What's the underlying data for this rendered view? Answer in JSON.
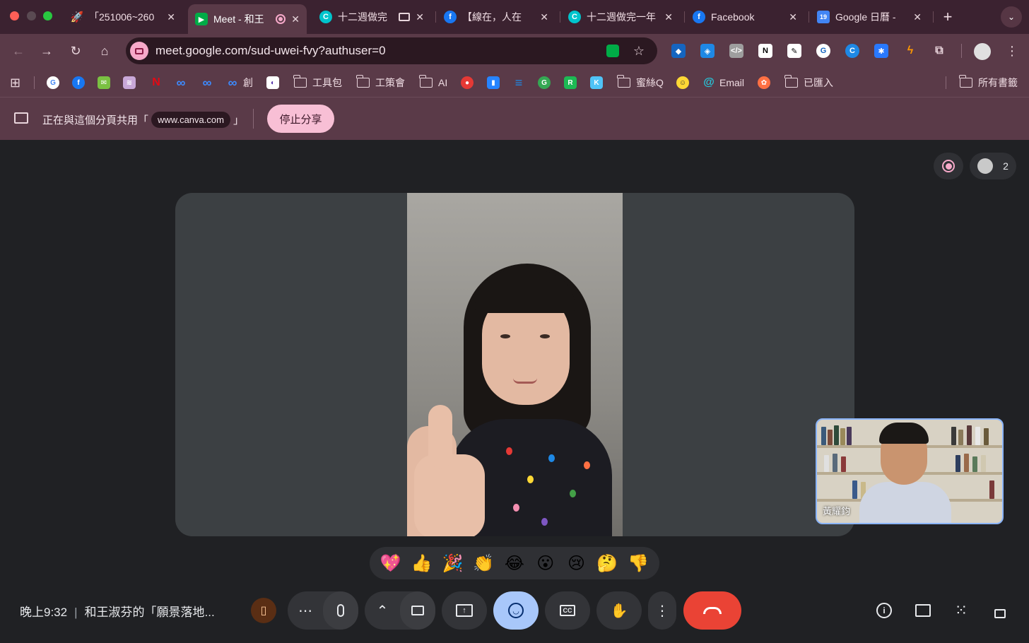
{
  "tabs": [
    {
      "title": "「251006~260",
      "favicon": "rocket-icon",
      "color": "#3b2230"
    },
    {
      "title": "Meet - 和王",
      "favicon": "meet-icon",
      "color": "#00ac47",
      "recording": true
    },
    {
      "title": "十二週做完",
      "favicon": "canva-icon",
      "color": "#00c4cc"
    },
    {
      "title": "【線在，人在",
      "favicon": "facebook-icon",
      "color": "#1877f2"
    },
    {
      "title": "十二週做完一年",
      "favicon": "canva-icon",
      "color": "#00c4cc"
    },
    {
      "title": "Facebook",
      "favicon": "facebook-icon",
      "color": "#1877f2"
    },
    {
      "title": "Google 日曆 -",
      "favicon": "calendar-icon",
      "color": "#4285f4",
      "badge": "19"
    }
  ],
  "tab_close_glyph": "✕",
  "new_tab_glyph": "+",
  "url": "meet.google.com/sud-uwei-fvy?authuser=0",
  "bookmarks": {
    "items": [
      {
        "label": "",
        "icon": "google-icon",
        "color": "#ffffff",
        "glyph": "G"
      },
      {
        "label": "",
        "icon": "facebook-icon",
        "color": "#1877f2",
        "glyph": "f"
      },
      {
        "label": "",
        "icon": "mail-icon",
        "color": "#7ac142",
        "glyph": "✉"
      },
      {
        "label": "",
        "icon": "pattern-icon",
        "color": "#c9a8d8",
        "glyph": "≋"
      },
      {
        "label": "",
        "icon": "netflix-icon",
        "color": "#e50914",
        "glyph": "N"
      },
      {
        "label": "",
        "icon": "meta-icon",
        "color": "#0668e1",
        "glyph": "∞"
      },
      {
        "label": "",
        "icon": "meta-icon",
        "color": "#0668e1",
        "glyph": "∞"
      },
      {
        "label": "創",
        "icon": "meta-icon",
        "color": "#0668e1",
        "glyph": "∞"
      },
      {
        "label": "",
        "icon": "app-icon",
        "color": "#ffffff",
        "glyph": "◐"
      },
      {
        "label": "工具包",
        "icon": "folder-icon"
      },
      {
        "label": "工策會",
        "icon": "folder-icon"
      },
      {
        "label": "AI",
        "icon": "folder-icon"
      },
      {
        "label": "",
        "icon": "red-app-icon",
        "color": "#e53935",
        "glyph": "●"
      },
      {
        "label": "",
        "icon": "trello-icon",
        "color": "#2684ff",
        "glyph": "▮"
      },
      {
        "label": "",
        "icon": "bars-icon",
        "color": "#1e88e5",
        "glyph": "≡"
      },
      {
        "label": "",
        "icon": "green-app-icon",
        "color": "#34a853",
        "glyph": "G"
      },
      {
        "label": "",
        "icon": "r-app-icon",
        "color": "#1db954",
        "glyph": "R"
      },
      {
        "label": "",
        "icon": "k-app-icon",
        "color": "#4fc3f7",
        "glyph": "K"
      },
      {
        "label": "蜜絲Q",
        "icon": "folder-icon"
      },
      {
        "label": "",
        "icon": "smile-app-icon",
        "color": "#fdd835",
        "glyph": "☺"
      },
      {
        "label": "Email",
        "icon": "email-app-icon",
        "color": "#26c6da",
        "glyph": "@"
      },
      {
        "label": "",
        "icon": "orange-app-icon",
        "color": "#ff7043",
        "glyph": "✿"
      },
      {
        "label": "已匯入",
        "icon": "folder-icon"
      }
    ],
    "all_bookmarks": "所有書籤"
  },
  "share_banner": {
    "prefix": "正在與這個分頁共用「",
    "host": "www.canva.com",
    "suffix": "」",
    "stop_label": "停止分享"
  },
  "participants_count": "2",
  "self_name": "黃耀鈞",
  "reactions": [
    "💖",
    "👍",
    "🎉",
    "👏",
    "😂",
    "😮",
    "😢",
    "🤔",
    "👎"
  ],
  "meeting": {
    "time": "晚上9:32",
    "divider": "|",
    "title": "和王淑芬的「願景落地..."
  },
  "controls": {
    "more_glyph": "⋯",
    "mic_glyph": "🎙",
    "up_glyph": "⌃",
    "present_glyph": "⇪",
    "emoji_glyph": "☺",
    "cc_label": "CC",
    "hand_glyph": "✋",
    "kebab_glyph": "⋮",
    "end_glyph": "☎",
    "info_glyph": "ⓘ",
    "chat_glyph": "▤",
    "apps_glyph": "⁙",
    "lock_glyph": "🔒"
  }
}
